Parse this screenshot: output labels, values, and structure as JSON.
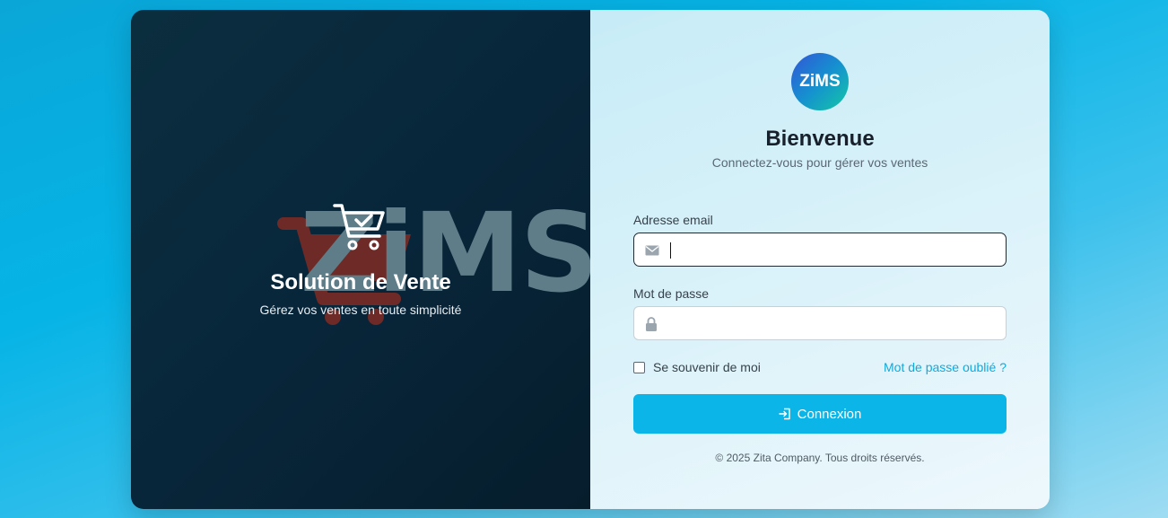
{
  "brand": {
    "watermark": "ZiMS",
    "logo_text": "ZiMS"
  },
  "hero": {
    "title": "Solution de Vente",
    "subtitle": "Gérez vos ventes en toute simplicité",
    "icon": "shopping-cart-check-icon"
  },
  "login": {
    "title": "Bienvenue",
    "subtitle": "Connectez-vous pour gérer vos ventes",
    "email": {
      "label": "Adresse email",
      "value": "",
      "placeholder": "",
      "icon": "envelope-icon"
    },
    "password": {
      "label": "Mot de passe",
      "value": "",
      "placeholder": "",
      "icon": "lock-icon"
    },
    "remember_label": "Se souvenir de moi",
    "remember_checked": false,
    "forgot_label": "Mot de passe oublié ?",
    "submit_label": "Connexion",
    "submit_icon": "sign-in-icon"
  },
  "footer": {
    "text": "© 2025 Zita Company. Tous droits réservés."
  },
  "colors": {
    "accent": "#0cb5e8",
    "link": "#12a9dd",
    "panel_dark": "#0b2e3f",
    "cart_watermark": "#6e2a26"
  }
}
